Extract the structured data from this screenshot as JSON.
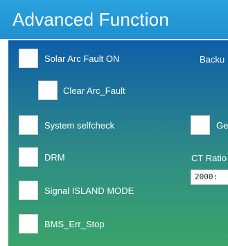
{
  "header": {
    "title": "Advanced Function"
  },
  "options_left": [
    {
      "label": "Solar Arc Fault ON",
      "checked": false
    },
    {
      "label": "Clear Arc_Fault",
      "checked": false
    },
    {
      "label": "System selfcheck",
      "checked": false
    },
    {
      "label": "DRM",
      "checked": false
    },
    {
      "label": "Signal ISLAND MODE",
      "checked": false
    },
    {
      "label": "BMS_Err_Stop",
      "checked": false
    }
  ],
  "options_right": {
    "backup_label": "Backu",
    "ge_label": "Ge",
    "ge_checked": false,
    "ct_ratio_label": "CT Ratio",
    "ct_ratio_value": "2000:"
  },
  "colors": {
    "header_bg": "#1f8fcf",
    "panel_top": "#0f5ea8",
    "panel_bottom": "#3aa46a"
  }
}
